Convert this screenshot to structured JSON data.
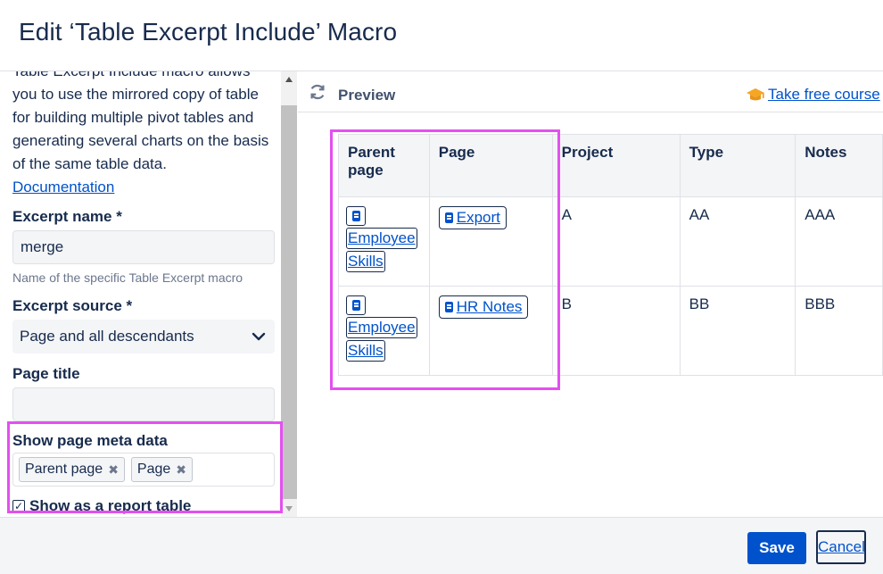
{
  "dialog": {
    "title": "Edit ‘Table Excerpt Include’ Macro"
  },
  "left_panel": {
    "description_lines": [
      "Table Excerpt Include macro allows",
      "you to use the mirrored copy of table",
      "for building multiple pivot tables and",
      "generating several charts on the basis",
      "of the same table data."
    ],
    "documentation_link": "Documentation",
    "excerpt_name": {
      "label": "Excerpt name *",
      "value": "merge",
      "help": "Name of the specific Table Excerpt macro"
    },
    "excerpt_source": {
      "label": "Excerpt source *",
      "selected": "Page and all descendants"
    },
    "page_title": {
      "label": "Page title",
      "value": ""
    },
    "page_meta": {
      "label": "Show page meta data",
      "tags": [
        "Parent page",
        "Page"
      ]
    },
    "report_table": {
      "label": "Show as a report table",
      "checked": true
    }
  },
  "preview": {
    "label": "Preview",
    "course_link": "Take free course",
    "columns": [
      "Parent page",
      "Page",
      "Project",
      "Type",
      "Notes"
    ],
    "rows": [
      {
        "parent_page": [
          "Employee",
          "Skills"
        ],
        "page": "Export",
        "project": "A",
        "type": "AA",
        "notes": "AAA"
      },
      {
        "parent_page": [
          "Employee",
          "Skills"
        ],
        "page": "HR Notes",
        "project": "B",
        "type": "BB",
        "notes": "BBB"
      }
    ]
  },
  "footer": {
    "save": "Save",
    "cancel": "Cancel"
  },
  "colors": {
    "primary": "#0052cc",
    "highlight": "#e44ff0",
    "text": "#172b4d",
    "course_icon": "#f5a623"
  }
}
